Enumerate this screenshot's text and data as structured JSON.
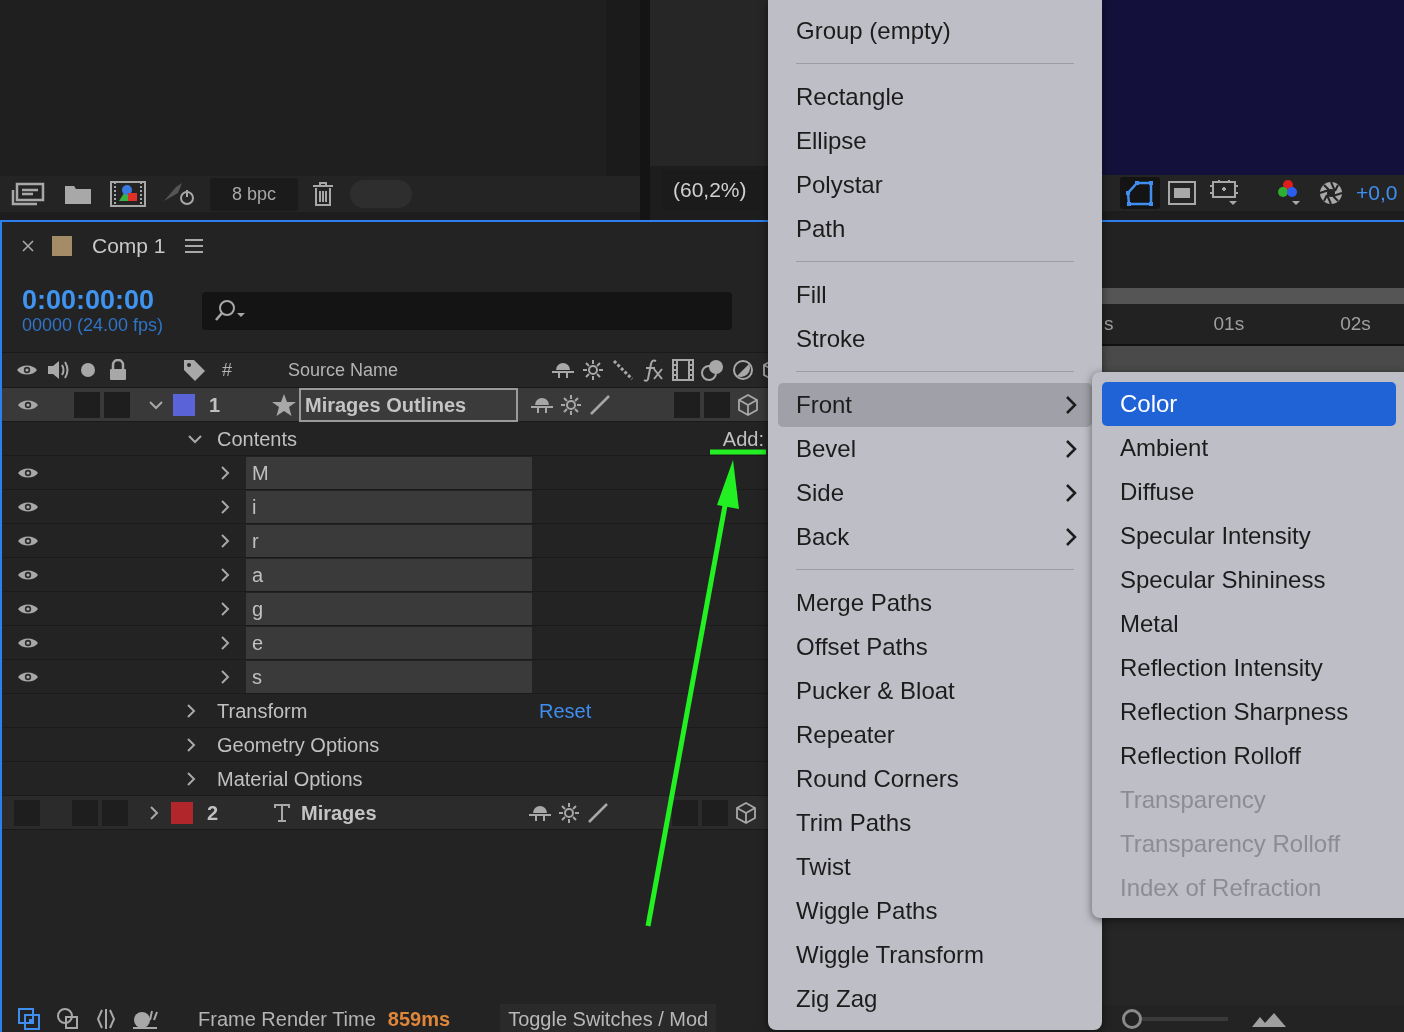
{
  "project_toolbar": {
    "bpc": "8 bpc"
  },
  "viewer_toolbar": {
    "zoom": "(60,2%)",
    "exposure": "+0,0"
  },
  "timeline": {
    "tab": "Comp 1",
    "timecode": "0:00:00:00",
    "frame_info": "00000 (24.00 fps)",
    "columns": [
      "#",
      "Source Name"
    ],
    "layers": [
      {
        "number": "1",
        "name": "Mirages Outlines",
        "kind": "shape",
        "color": "#5a63d8",
        "visible": true,
        "expanded": true,
        "selected": true,
        "children": [
          {
            "label": "Contents",
            "expanded": true,
            "action": {
              "label": "Add:",
              "kind": "menu"
            },
            "children": [
              {
                "label": "M",
                "visible": true,
                "expanded": false
              },
              {
                "label": "i",
                "visible": true,
                "expanded": false
              },
              {
                "label": "r",
                "visible": true,
                "expanded": false
              },
              {
                "label": "a",
                "visible": true,
                "expanded": false
              },
              {
                "label": "g",
                "visible": true,
                "expanded": false
              },
              {
                "label": "e",
                "visible": true,
                "expanded": false
              },
              {
                "label": "s",
                "visible": true,
                "expanded": false
              }
            ]
          },
          {
            "label": "Transform",
            "expanded": false,
            "action": {
              "label": "Reset",
              "kind": "link"
            }
          },
          {
            "label": "Geometry Options",
            "expanded": false
          },
          {
            "label": "Material Options",
            "expanded": false
          }
        ]
      },
      {
        "number": "2",
        "name": "Mirages",
        "kind": "text",
        "color": "#b0262a",
        "visible": false,
        "expanded": false,
        "selected": false
      }
    ],
    "ruler": [
      "s",
      "01s",
      "02s"
    ]
  },
  "status_bar": {
    "label": "Frame Render Time",
    "render_time": "859ms",
    "toggle": "Toggle Switches / Mod",
    "zoom_slider": {
      "level": 0
    }
  },
  "context_menu": {
    "groups": [
      [
        {
          "label": "Group (empty)",
          "submenu": false,
          "selected": false
        }
      ],
      [
        {
          "label": "Rectangle",
          "submenu": false,
          "selected": false
        },
        {
          "label": "Ellipse",
          "submenu": false,
          "selected": false
        },
        {
          "label": "Polystar",
          "submenu": false,
          "selected": false
        },
        {
          "label": "Path",
          "submenu": false,
          "selected": false
        }
      ],
      [
        {
          "label": "Fill",
          "submenu": false,
          "selected": false
        },
        {
          "label": "Stroke",
          "submenu": false,
          "selected": false
        }
      ],
      [
        {
          "label": "Front",
          "submenu": true,
          "selected": true
        },
        {
          "label": "Bevel",
          "submenu": true,
          "selected": false
        },
        {
          "label": "Side",
          "submenu": true,
          "selected": false
        },
        {
          "label": "Back",
          "submenu": true,
          "selected": false
        }
      ],
      [
        {
          "label": "Merge Paths",
          "submenu": false,
          "selected": false
        },
        {
          "label": "Offset Paths",
          "submenu": false,
          "selected": false
        },
        {
          "label": "Pucker & Bloat",
          "submenu": false,
          "selected": false
        },
        {
          "label": "Repeater",
          "submenu": false,
          "selected": false
        },
        {
          "label": "Round Corners",
          "submenu": false,
          "selected": false
        },
        {
          "label": "Trim Paths",
          "submenu": false,
          "selected": false
        },
        {
          "label": "Twist",
          "submenu": false,
          "selected": false
        },
        {
          "label": "Wiggle Paths",
          "submenu": false,
          "selected": false
        },
        {
          "label": "Wiggle Transform",
          "submenu": false,
          "selected": false
        },
        {
          "label": "Zig Zag",
          "submenu": false,
          "selected": false
        }
      ]
    ]
  },
  "submenu": {
    "items": [
      {
        "label": "Color",
        "selected": true,
        "disabled": false
      },
      {
        "label": "Ambient",
        "selected": false,
        "disabled": false
      },
      {
        "label": "Diffuse",
        "selected": false,
        "disabled": false
      },
      {
        "label": "Specular Intensity",
        "selected": false,
        "disabled": false
      },
      {
        "label": "Specular Shininess",
        "selected": false,
        "disabled": false
      },
      {
        "label": "Metal",
        "selected": false,
        "disabled": false
      },
      {
        "label": "Reflection Intensity",
        "selected": false,
        "disabled": false
      },
      {
        "label": "Reflection Sharpness",
        "selected": false,
        "disabled": false
      },
      {
        "label": "Reflection Rolloff",
        "selected": false,
        "disabled": false
      },
      {
        "label": "Transparency",
        "selected": false,
        "disabled": true
      },
      {
        "label": "Transparency Rolloff",
        "selected": false,
        "disabled": true
      },
      {
        "label": "Index of Refraction",
        "selected": false,
        "disabled": true
      }
    ]
  }
}
